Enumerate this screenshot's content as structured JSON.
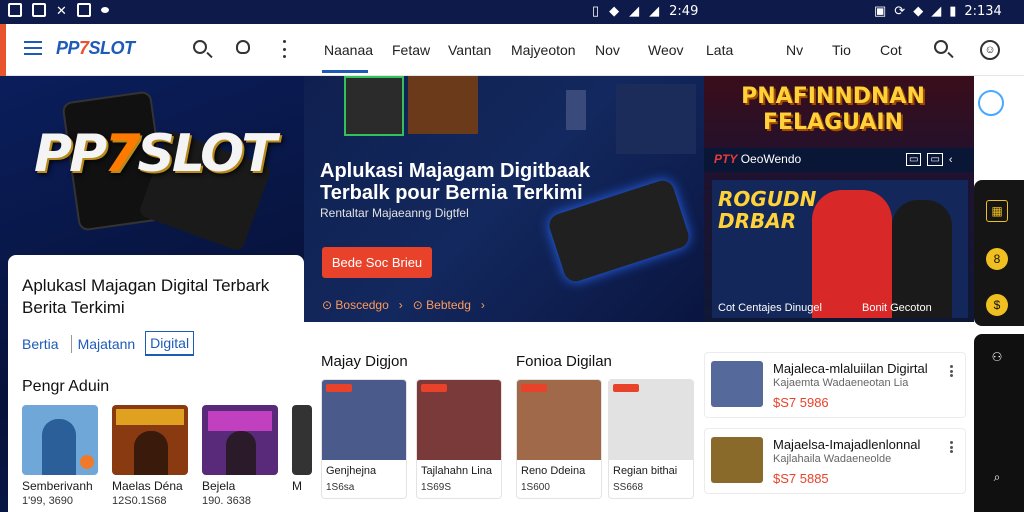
{
  "status_bar": {
    "time_center": "2:49",
    "time_right": "2:134"
  },
  "header": {
    "brand_prefix": "PP",
    "brand_seven": "7",
    "brand_suffix": "SLOT",
    "nav": [
      {
        "label": "Naanaa",
        "active": true
      },
      {
        "label": "Fetaw"
      },
      {
        "label": "Vantan"
      },
      {
        "label": "Majyeoton"
      },
      {
        "label": "Nov"
      },
      {
        "label": "Weov"
      },
      {
        "label": "Lata"
      },
      {
        "label": "Nv"
      },
      {
        "label": "Tio"
      },
      {
        "label": "Cot"
      }
    ]
  },
  "left_hero": {
    "logo_prefix": "PP",
    "logo_seven": "7",
    "logo_suffix": "SLOT"
  },
  "left_card": {
    "title": "Aplukasl Majagan Digital Terbark Berita Terkimi",
    "tabs": [
      "Bertia",
      "Majatann",
      "Digital"
    ],
    "section_title": "Pengr Aduin",
    "items": [
      {
        "name": "Semberivanh",
        "price": "1'99, 3690",
        "color": "#6fa8d8"
      },
      {
        "name": "Maelas Déna",
        "price": "12S0.1S68",
        "color": "#8a3a10"
      },
      {
        "name": "Bejela",
        "price": "190. 3638",
        "color": "#5a2a7a"
      },
      {
        "name": "M",
        "price": "",
        "color": "#333333"
      }
    ]
  },
  "center_banner": {
    "title": "Aplukasi Majagam Digitbaak Terbalk pour Bernia Terkimi",
    "subtitle": "Rentaltar Majaeanng Digtfel",
    "button_label": "Bede Soc Brieu",
    "link1": "Boscedgo",
    "link2": "Bebtedg"
  },
  "right_promo": {
    "headline_line1": "PNAFINNDNAN",
    "headline_line2": "FELAGUAIN",
    "brand": "PTY",
    "brand_text": "OeoWendo",
    "card_text_line1": "ROGUDN",
    "card_text_line2": "DRBAR",
    "footer_left": "Cot Centajes Dinugel",
    "footer_right": "Bonit Gecoton"
  },
  "rail": {
    "buttons": [
      "8",
      "$"
    ]
  },
  "sections": [
    {
      "title": "Majay Digjon",
      "items": [
        {
          "name": "Genjhejna",
          "price": "1S6sa",
          "color": "#4a5a8a"
        },
        {
          "name": "Tajlahahn Lina",
          "price": "1S69S",
          "color": "#7a3a3a"
        }
      ]
    },
    {
      "title": "Fonioa Digilan",
      "items": [
        {
          "name": "Reno Ddeina",
          "price": "1S600",
          "color": "#a06a4a"
        },
        {
          "name": "Regian bithai",
          "price": "SS668",
          "color": "#e2e2e2"
        }
      ]
    }
  ],
  "list": [
    {
      "title": "Majaleca-mlaluiilan Digirtal",
      "subtitle": "Kajaemta Wadaeneotan Lia",
      "price": "$S7 5986",
      "color": "#556a9a"
    },
    {
      "title": "Majaelsa-Imajadlenlonnal",
      "subtitle": "Kajlahaila Wadaeneolde",
      "price": "$S7 5885",
      "color": "#8a6a2a"
    }
  ]
}
